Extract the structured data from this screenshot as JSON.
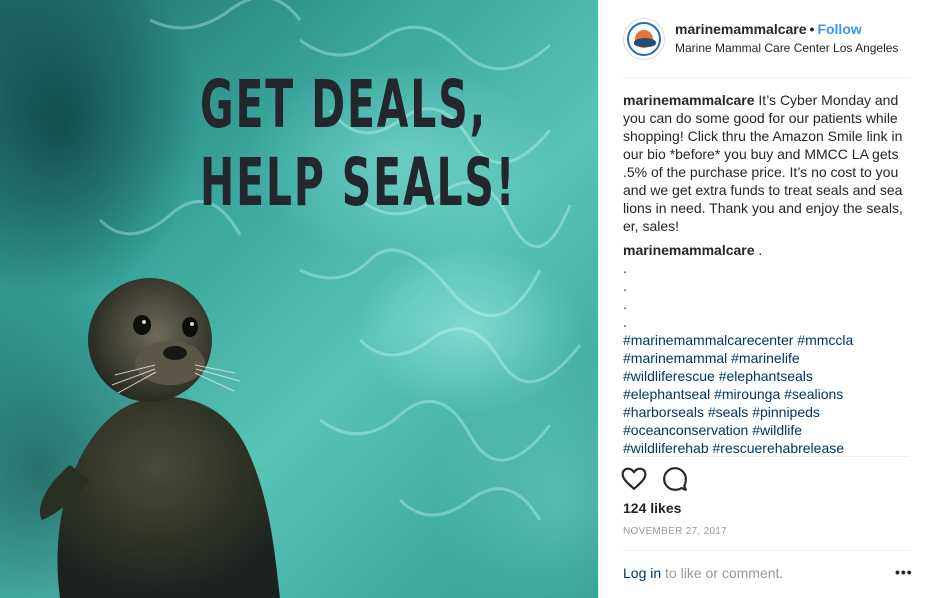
{
  "photo": {
    "headline_line1": "GET DEALS,",
    "headline_line2": "HELP SEALS!"
  },
  "post": {
    "username": "marinemammalcare",
    "follow_label": "Follow",
    "location": "Marine Mammal Care Center Los Angeles"
  },
  "caption": {
    "username": "marinemammalcare",
    "text": "It’s Cyber Monday and you can do some good for our patients while shopping! Click thru the Amazon Smile link in our bio *before* you buy and MMCC LA gets .5% of the purchase price. It’s no cost to you and we get extra funds to treat seals and sea lions in need. Thank you and enjoy the seals, er, sales!"
  },
  "comment": {
    "username": "marinemammalcare",
    "text": ".",
    "dots": [
      ".",
      ".",
      ".",
      "."
    ],
    "hashtags": [
      [
        "#marinemammalcarecenter",
        "#mmccla"
      ],
      [
        "#marinemammal",
        "#marinelife"
      ],
      [
        "#wildliferescue",
        "#elephantseals"
      ],
      [
        "#elephantseal",
        "#mirounga",
        "#sealions"
      ],
      [
        "#harborseals",
        "#seals",
        "#pinnipeds"
      ],
      [
        "#oceanconservation",
        "#wildlife"
      ],
      [
        "#wildliferehab",
        "#rescuerehabrelease"
      ]
    ]
  },
  "stats": {
    "likes": "124 likes",
    "date": "November 27, 2017"
  },
  "footer": {
    "login_link": "Log in",
    "login_text": " to like or comment.",
    "more_label": "•••"
  },
  "icons": {
    "like": "heart-icon",
    "comment": "comment-icon",
    "more": "more-options-icon"
  },
  "colors": {
    "follow": "#3897f0",
    "hashtag": "#003569",
    "secondary_text": "#999999"
  }
}
